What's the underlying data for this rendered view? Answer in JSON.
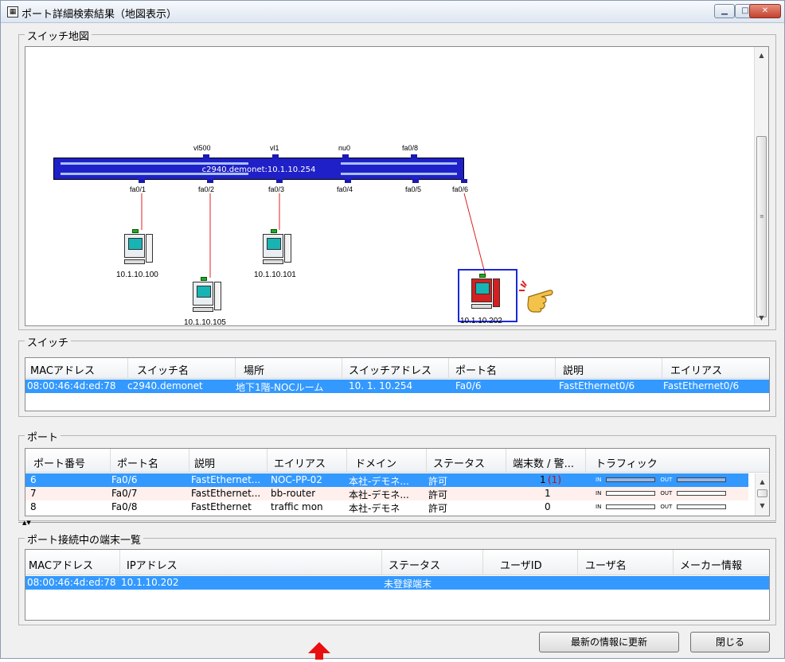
{
  "window": {
    "title": "ポート詳細検索結果（地図表示）",
    "min_icon": "minimize-icon",
    "max_icon": "maximize-icon",
    "close_icon": "close-icon"
  },
  "map": {
    "group_label": "スイッチ地図",
    "switch_name": "c2940.demonet:10.1.10.254",
    "top_ports": [
      "vl500",
      "vl1",
      "nu0",
      "fa0/8"
    ],
    "bottom_ports": [
      "fa0/1",
      "fa0/2",
      "fa0/3",
      "fa0/4",
      "fa0/5",
      "fa0/6"
    ],
    "terminals": [
      "10.1.10.100",
      "10.1.10.105",
      "10.1.10.101",
      "10.1.10.202"
    ],
    "pointer_icon": "pointing-hand-icon"
  },
  "switch": {
    "group_label": "スイッチ",
    "headers": [
      "MACアドレス",
      "スイッチ名",
      "場所",
      "スイッチアドレス",
      "ポート名",
      "説明",
      "エイリアス"
    ],
    "rows": [
      [
        "08:00:46:4d:ed:78",
        "c2940.demonet",
        "地下1階-NOCルーム",
        "10. 1. 10.254",
        "Fa0/6",
        "FastEthernet0/6",
        "FastEthernet0/6"
      ]
    ]
  },
  "ports": {
    "group_label": "ポート",
    "headers": [
      "ポート番号",
      "ポート名",
      "説明",
      "エイリアス",
      "ドメイン",
      "ステータス",
      "端末数 / 警...",
      "トラフィック"
    ],
    "rows": [
      {
        "num": "6",
        "name": "Fa0/6",
        "desc": "FastEthernet...",
        "alias": "NOC-PP-02",
        "domain": "本社-デモネ...",
        "status": "許可",
        "count": "1",
        "warn": "(1)",
        "in": "IN",
        "out": "OUT"
      },
      {
        "num": "7",
        "name": "Fa0/7",
        "desc": "FastEthernet...",
        "alias": "bb-router",
        "domain": "本社-デモネ...",
        "status": "許可",
        "count": "1",
        "warn": "",
        "in": "IN",
        "out": "OUT"
      },
      {
        "num": "8",
        "name": "Fa0/8",
        "desc": "FastEthernet",
        "alias": "traffic mon",
        "domain": "本社-デモネ",
        "status": "許可",
        "count": "0",
        "warn": "",
        "in": "IN",
        "out": "OUT"
      }
    ]
  },
  "terminals": {
    "group_label": "ポート接続中の端末一覧",
    "headers": [
      "MACアドレス",
      "IPアドレス",
      "ステータス",
      "ユーザID",
      "ユーザ名",
      "メーカー情報"
    ],
    "rows": [
      [
        "08:00:46:4d:ed:78",
        "10.1.10.202",
        "未登録端末",
        "",
        "",
        ""
      ]
    ]
  },
  "buttons": {
    "refresh": "最新の情報に更新",
    "close": "閉じる"
  },
  "colors": {
    "selection": "#3399ff",
    "switch": "#2020c8",
    "annotation_arrow": "#e81010"
  }
}
